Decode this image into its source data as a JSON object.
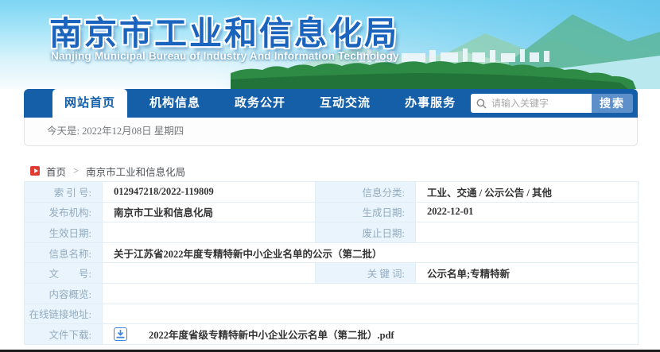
{
  "header": {
    "title": "南京市工业和信息化局",
    "subtitle": "Nanjing Municipal Bureau of Industry And Information Technology"
  },
  "nav": {
    "tabs": [
      {
        "label": "网站首页",
        "active": true
      },
      {
        "label": "机构信息",
        "active": false
      },
      {
        "label": "政务公开",
        "active": false
      },
      {
        "label": "互动交流",
        "active": false
      },
      {
        "label": "办事服务",
        "active": false
      }
    ],
    "search": {
      "placeholder": "请输入关键字",
      "button_label": "搜索",
      "icon": "search-icon"
    }
  },
  "date_bar": {
    "text": "今天是: 2022年12月08日 星期四"
  },
  "breadcrumb": {
    "home": "首页",
    "separator": ">",
    "current": "南京市工业和信息化局",
    "icon": "breadcrumb-home-icon"
  },
  "infotable": {
    "rows": [
      {
        "label1": "索 引 号:",
        "value1": "012947218/2022-119809",
        "label2": "信息分类:",
        "value2": "工业、交通 / 公示公告 / 其他"
      },
      {
        "label1": "发布机构:",
        "value1": "南京市工业和信息化局",
        "label2": "生成日期:",
        "value2": "2022-12-01"
      },
      {
        "label1": "生效日期:",
        "value1": "",
        "label2": "废止日期:",
        "value2": ""
      },
      {
        "label1": "信息名称:",
        "value1": "关于江苏省2022年度专精特新中小企业名单的公示（第二批）"
      },
      {
        "label1": "文　　号:",
        "value1": "",
        "label2": "关 键 词:",
        "value2": "公示名单;专精特新"
      },
      {
        "label1": "内容概览:",
        "value1": ""
      },
      {
        "label1": "在线链接地址:",
        "value1": ""
      },
      {
        "label1": "文件下载:",
        "file_name": "2022年度省级专精特新中小企业公示名单（第二批）.pdf",
        "icon": "download-icon"
      }
    ]
  },
  "colors": {
    "nav_blue": "#155fa8",
    "search_button_blue": "#5d90cb",
    "title_blue": "#1b64be",
    "label_cell_bg": "#e9f4fc",
    "label_text": "#93abbf",
    "value_text": "#333333",
    "breadcrumb_icon_red": "#e03c31",
    "download_icon_blue": "#3f86e0"
  }
}
